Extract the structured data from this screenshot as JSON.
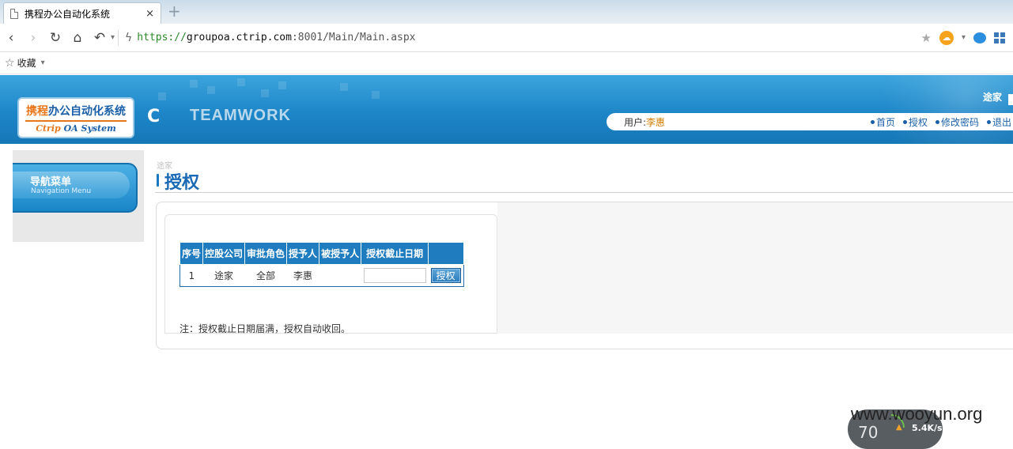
{
  "browser": {
    "tab_title": "携程办公自动化系统",
    "tab_close": "×",
    "new_tab": "+",
    "url_scheme": "https://",
    "url_host": "groupoa.ctrip.com",
    "url_rest": ":8001/Main/Main.aspx",
    "favorites_label": "收藏"
  },
  "header": {
    "logo_cn_highlight": "携程",
    "logo_cn_rest": "办公自动化系统",
    "logo_en_a": "Ctrip",
    "logo_en_b": "OA System",
    "brand_c": "C",
    "brand_teamwork": "TEAMWORK",
    "top_user": "途家",
    "user_label": "用户: ",
    "user_name": "李惠",
    "links": [
      "首页",
      "授权",
      "修改密码",
      "退出"
    ]
  },
  "nav": {
    "title": "导航菜单",
    "subtitle": "Navigation Menu"
  },
  "main": {
    "breadcrumb": "途家",
    "page_title": "授权",
    "table": {
      "headers": [
        "序号",
        "控股公司",
        "审批角色",
        "授予人",
        "被授予人",
        "授权截止日期",
        ""
      ],
      "rows": [
        {
          "index": "1",
          "company": "途家",
          "role": "全部",
          "grantor": "李惠",
          "grantee": "",
          "deadline": ""
        }
      ],
      "grant_button": "授权"
    },
    "note": "注：授权截止日期届满，授权自动收回。"
  },
  "overlay": {
    "watermark": "www.wooyun.org",
    "speed_value": "70",
    "speed_rate": "5.4K/s"
  }
}
